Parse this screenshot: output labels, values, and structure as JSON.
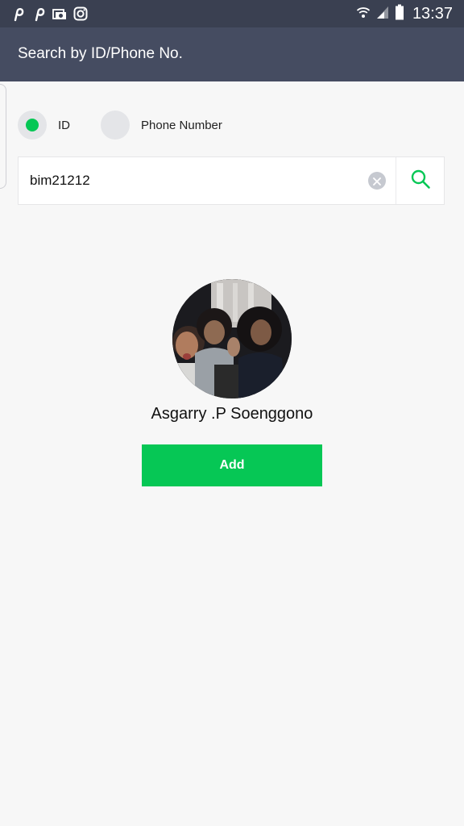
{
  "status_bar": {
    "time": "13:37",
    "left_icons": [
      "pinterest-icon",
      "pinterest-icon",
      "gallery-icon",
      "instagram-icon"
    ],
    "right_icons": [
      "wifi-icon",
      "signal-icon",
      "battery-icon"
    ]
  },
  "header": {
    "title": "Search by ID/Phone No."
  },
  "search_type": {
    "options": [
      {
        "label": "ID",
        "selected": true
      },
      {
        "label": "Phone Number",
        "selected": false
      }
    ]
  },
  "search": {
    "value": "bim21212"
  },
  "result": {
    "name": "Asgarry .P Soenggono",
    "add_label": "Add"
  },
  "colors": {
    "accent": "#06c755",
    "header_bg": "#454c61",
    "status_bg": "#3a4051",
    "page_bg": "#f7f7f7"
  }
}
